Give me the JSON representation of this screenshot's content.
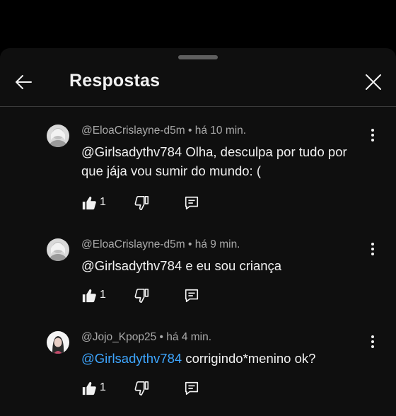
{
  "header": {
    "title": "Respostas",
    "back_icon": "arrow-left-icon",
    "close_icon": "close-icon"
  },
  "comments": [
    {
      "author": "@EloaCrislayne-d5m",
      "separator": " • ",
      "time": "há 10 min.",
      "mention": "@Girlsadythv784",
      "text": "  Olha, desculpa por tudo por que jája vou sumir do mundo: (",
      "likes": "1"
    },
    {
      "author": "@EloaCrislayne-d5m",
      "separator": " • ",
      "time": "há 9 min.",
      "mention": "@Girlsadythv784",
      "text": "  e eu sou criança",
      "likes": "1"
    },
    {
      "author": "@Jojo_Kpop25",
      "separator": " • ",
      "time": "há 4 min.",
      "mention": " @Girlsadythv784",
      "text": " corrigindo*menino ok?",
      "likes": "1"
    }
  ],
  "colors": {
    "background": "#000000",
    "sheet": "#0f0f0f",
    "text": "#f1f1f1",
    "meta": "#aaaaaa",
    "link": "#3ea6ff"
  }
}
